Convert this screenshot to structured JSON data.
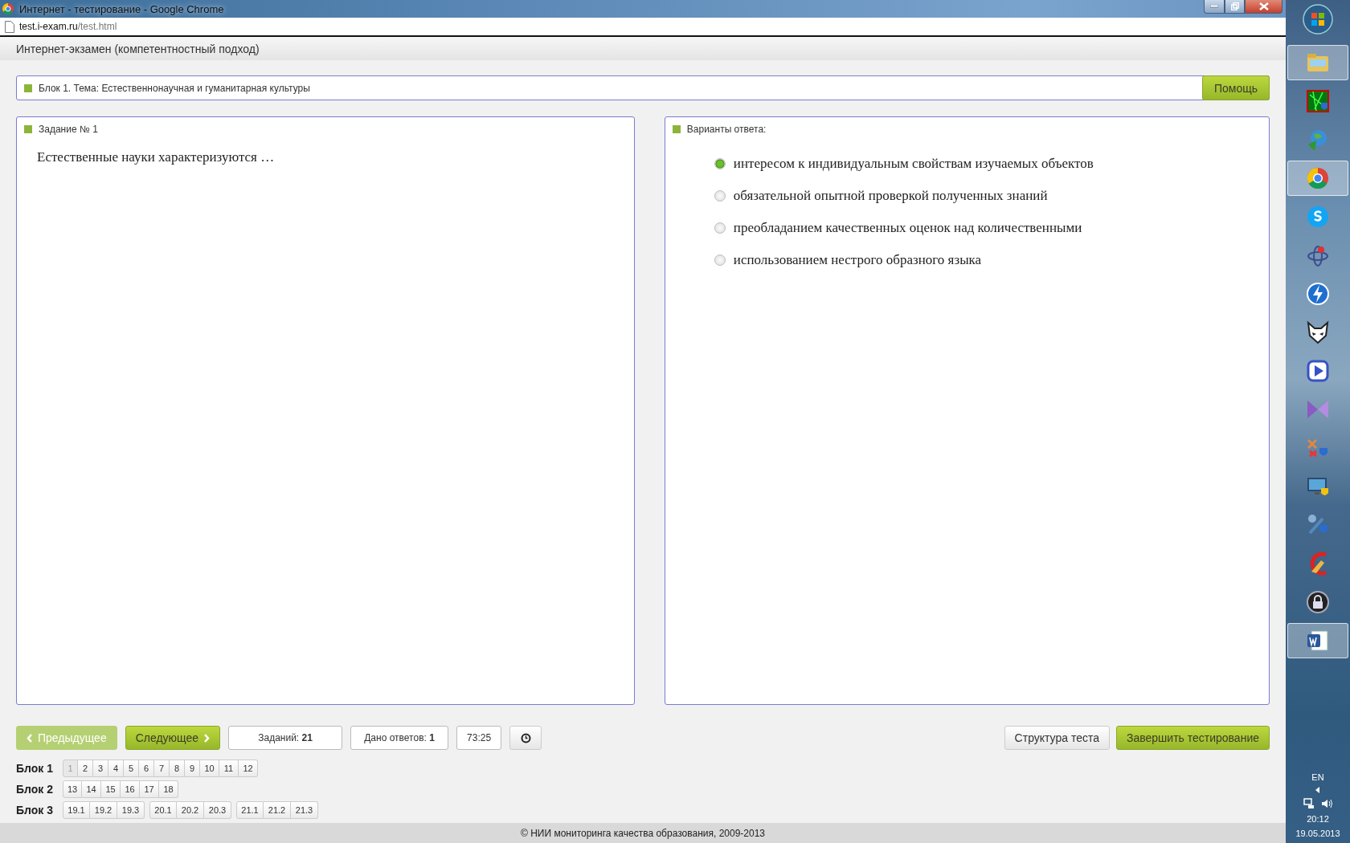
{
  "browser": {
    "title": "Интернет - тестирование - Google Chrome",
    "url_host": "test.i-exam.ru",
    "url_path": "/test.html"
  },
  "header": {
    "title": "Интернет-экзамен (компетентностный подход)"
  },
  "block_bar": {
    "label": "Блок 1. Тема: Естественнонаучная и гуманитарная культуры",
    "help_button": "Помощь"
  },
  "task": {
    "heading": "Задание № 1",
    "question": "Естественные науки характеризуются …"
  },
  "answers": {
    "heading": "Варианты ответа:",
    "options": [
      {
        "label": "интересом к индивидуальным свойствам изучаемых объектов",
        "selected": true
      },
      {
        "label": "обязательной опытной проверкой полученных знаний",
        "selected": false
      },
      {
        "label": "преобладанием качественных оценок над количественными",
        "selected": false
      },
      {
        "label": "использованием нестрого образного языка",
        "selected": false
      }
    ]
  },
  "controls": {
    "prev": {
      "label": "Предыдущее",
      "disabled": true
    },
    "next": {
      "label": "Следующее",
      "disabled": false
    },
    "tasks_count": "Заданий: **21**",
    "answered": "Дано ответов: **1**",
    "timer": "73:25",
    "structure_button": "Структура теста",
    "finish_button": "Завершить тестирование"
  },
  "blocks": [
    {
      "label": "Блок 1",
      "groups": [
        {
          "items": [
            {
              "label": "1",
              "selected": true
            },
            {
              "label": "2",
              "selected": false
            },
            {
              "label": "3",
              "selected": false
            },
            {
              "label": "4",
              "selected": false
            },
            {
              "label": "5",
              "selected": false
            },
            {
              "label": "6",
              "selected": false
            },
            {
              "label": "7",
              "selected": false
            },
            {
              "label": "8",
              "selected": false
            },
            {
              "label": "9",
              "selected": false
            },
            {
              "label": "10",
              "selected": false
            },
            {
              "label": "11",
              "selected": false
            },
            {
              "label": "12",
              "selected": false
            }
          ]
        }
      ]
    },
    {
      "label": "Блок 2",
      "groups": [
        {
          "items": [
            {
              "label": "13",
              "selected": false
            },
            {
              "label": "14",
              "selected": false
            },
            {
              "label": "15",
              "selected": false
            },
            {
              "label": "16",
              "selected": false
            },
            {
              "label": "17",
              "selected": false
            },
            {
              "label": "18",
              "selected": false
            }
          ]
        }
      ]
    },
    {
      "label": "Блок 3",
      "groups": [
        {
          "items": [
            {
              "label": "19.1",
              "selected": false
            },
            {
              "label": "19.2",
              "selected": false
            },
            {
              "label": "19.3",
              "selected": false
            }
          ]
        },
        {
          "items": [
            {
              "label": "20.1",
              "selected": false
            },
            {
              "label": "20.2",
              "selected": false
            },
            {
              "label": "20.3",
              "selected": false
            }
          ]
        },
        {
          "items": [
            {
              "label": "21.1",
              "selected": false
            },
            {
              "label": "21.2",
              "selected": false
            },
            {
              "label": "21.3",
              "selected": false
            }
          ]
        }
      ]
    }
  ],
  "footer": "© НИИ мониторинга качества образования, 2009-2013",
  "taskbar": {
    "apps": [
      {
        "kind": "folder",
        "active": true
      },
      {
        "kind": "matrix",
        "active": false
      },
      {
        "kind": "globe",
        "active": false
      },
      {
        "kind": "chrome",
        "active": true
      },
      {
        "kind": "skype",
        "active": false
      },
      {
        "kind": "atom",
        "active": false
      },
      {
        "kind": "bolt",
        "active": false
      },
      {
        "kind": "fox",
        "active": false
      },
      {
        "kind": "play",
        "active": false
      },
      {
        "kind": "bowtie",
        "active": false
      },
      {
        "kind": "shield",
        "active": false
      },
      {
        "kind": "monitor",
        "active": false
      },
      {
        "kind": "tools",
        "active": false
      },
      {
        "kind": "broom",
        "active": false
      },
      {
        "kind": "lock",
        "active": false
      },
      {
        "kind": "document",
        "active": true
      }
    ],
    "language": "EN",
    "time": "20:12",
    "date": "19.05.2013"
  }
}
